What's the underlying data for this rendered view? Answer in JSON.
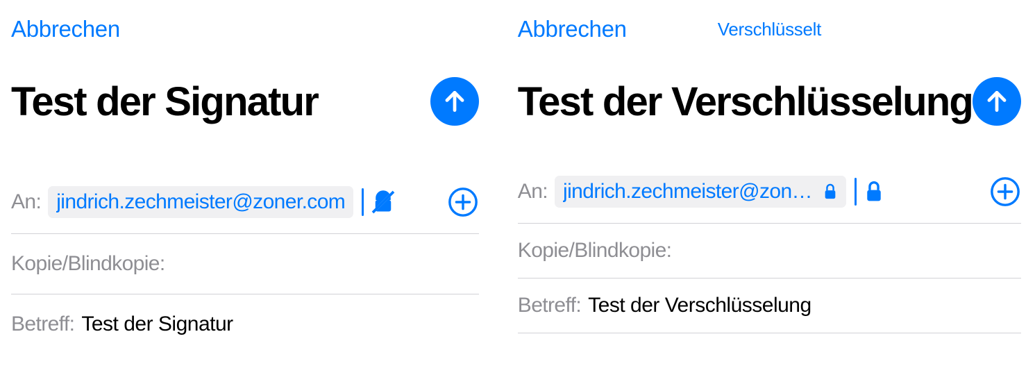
{
  "left": {
    "cancel": "Abbrechen",
    "title": "Test der Signatur",
    "to_label": "An:",
    "recipient": "jindrich.zechmeister@zoner.com",
    "cc_label": "Kopie/Blindkopie:",
    "subject_label": "Betreff:",
    "subject_value": "Test der Signatur"
  },
  "right": {
    "cancel": "Abbrechen",
    "encrypted_label": "Verschlüsselt",
    "title": "Test der Verschlüsselung",
    "to_label": "An:",
    "recipient": "jindrich.zechmeister@zoner.c...",
    "cc_label": "Kopie/Blindkopie:",
    "subject_label": "Betreff:",
    "subject_value": "Test der Verschlüsselung"
  },
  "colors": {
    "accent": "#007aff",
    "muted": "#8e8e93"
  }
}
